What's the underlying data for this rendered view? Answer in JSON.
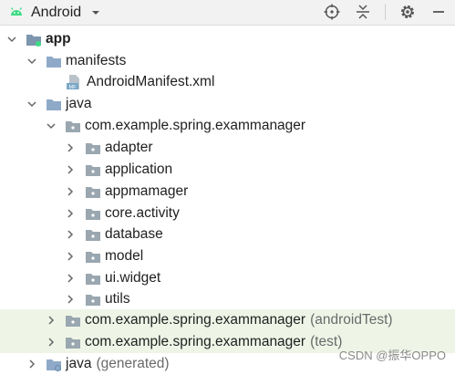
{
  "toolbar": {
    "view_name": "Android",
    "icons": [
      "android-icon",
      "chevron-down-icon",
      "crosshair-icon",
      "collapse-icon",
      "gear-icon",
      "minimize-icon"
    ]
  },
  "tree": {
    "app": "app",
    "manifests": "manifests",
    "android_manifest": "AndroidManifest.xml",
    "manifest_badge": "MF",
    "java": "java",
    "main_package": "com.example.spring.exammanager",
    "folders": [
      "adapter",
      "application",
      "appmamager",
      "core.activity",
      "database",
      "model",
      "ui.widget",
      "utils"
    ],
    "android_test_package": "com.example.spring.exammanager",
    "android_test_suffix": "(androidTest)",
    "test_package": "com.example.spring.exammanager",
    "test_suffix": "(test)",
    "java_generated": "java",
    "java_generated_suffix": "(generated)"
  },
  "watermark": "CSDN @振华OPPO",
  "colors": {
    "folder": "#9aa7b0",
    "module_folder": "#6e8fb1",
    "highlight": "#eef5e7",
    "android_green": "#3ddc84"
  }
}
